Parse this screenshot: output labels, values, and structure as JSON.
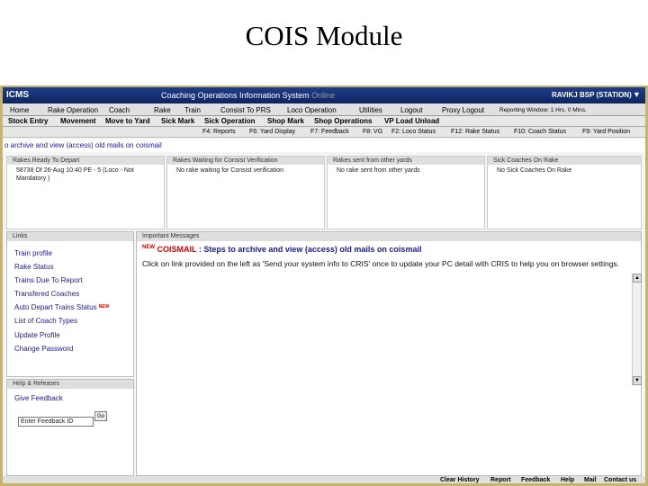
{
  "slide": {
    "title": "COIS Module"
  },
  "header": {
    "logo": "ICMS",
    "system_name": "Coaching Operations Information System",
    "system_status": "Online",
    "user": "RAVIKJ BSP (STATION)",
    "dropdown_glyph": "▼"
  },
  "menu": {
    "items": [
      "Home",
      "Rake Operation",
      "Coach",
      "Rake",
      "Train",
      "Consist To PRS",
      "Loco Operation",
      "Utilities",
      "Logout",
      "Proxy Logout"
    ],
    "reporting_window": "Reporting Window: 1 Hrs. 0 Mins."
  },
  "toolbar": {
    "items": [
      "Stock Entry",
      "Movement",
      "Move to Yard",
      "Sick Mark",
      "Sick Operation",
      "Shop Mark",
      "Shop Operations",
      "VP Load Unload"
    ]
  },
  "fkeys": {
    "items": [
      "F4: Reports",
      "F6: Yard Display",
      "F7: Feedback",
      "F8: VG",
      "F2: Loco Status",
      "F12: Rake Status",
      "F10: Coach Status",
      "F9: Yard Position"
    ]
  },
  "ticker": {
    "text": "o archive and view (access) old mails on coismail"
  },
  "panels": [
    {
      "title": "Rakes Ready To Depart",
      "body": "58738 Of 26-Aug 10:40 PE - 5 (Loco - Not Mandatory )"
    },
    {
      "title": "Rakes Waiting for Consist Verification",
      "body": "No rake waiting for Consist verification"
    },
    {
      "title": "Rakes sent from other yards",
      "body": "No rake sent from other yards"
    },
    {
      "title": "Sick Coaches On Rake",
      "body": "No Sick Coaches On Rake"
    }
  ],
  "links": {
    "title": "Links",
    "items": [
      "Train profile",
      "Rake Status",
      "Trains Due To Report",
      "Transfered Coaches",
      "Auto Depart Trains Status",
      "List of Coach Types",
      "Update Profile",
      "Change Password"
    ],
    "new_tag": "NEW"
  },
  "help": {
    "title": "Help & Releases",
    "feedback_link": "Give Feedback",
    "feedback_input_value": "Enter Feedback ID",
    "go_label": "Go"
  },
  "messages": {
    "title": "Important Messages",
    "new_tag": "NEW",
    "headline_red": "COISMAIL",
    "headline_rest": " : Steps to archive and view (access) old mails on coismail",
    "body": "Click on link provided on the left as 'Send your system info to CRIS' once to update your PC detail with CRIS to help you on browser settings."
  },
  "footer": {
    "items": [
      "Clear History",
      "Report",
      "Feedback",
      "Help",
      "Mail",
      "Contact us"
    ]
  }
}
